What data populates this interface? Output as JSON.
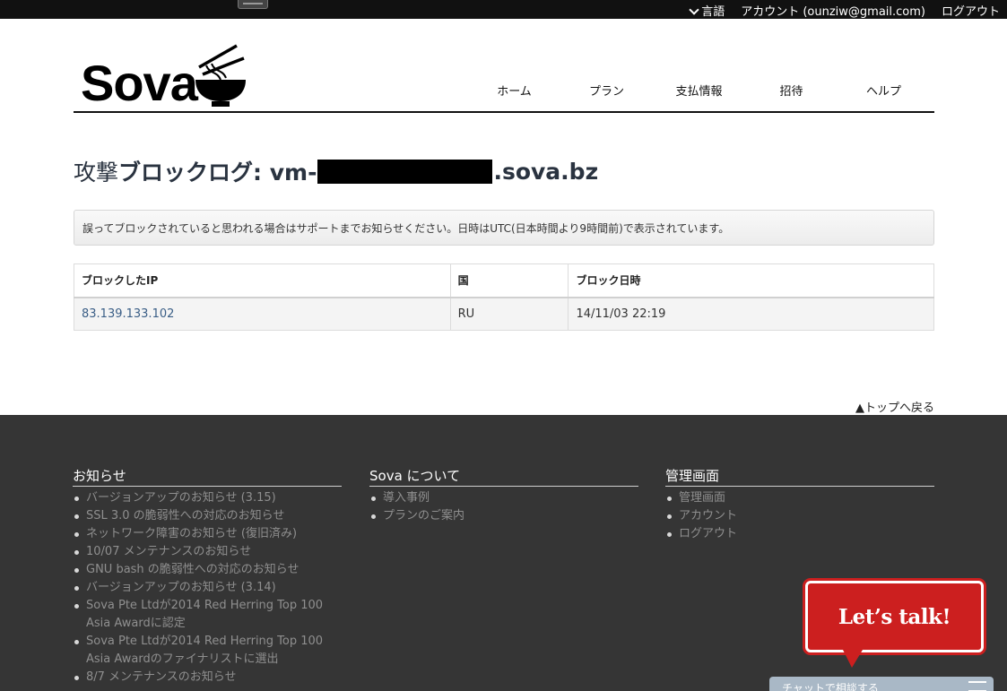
{
  "topbar": {
    "language": "言語",
    "account": "アカウント (ounziw@gmail.com)",
    "logout": "ログアウト"
  },
  "brand": {
    "name": "Sova"
  },
  "nav": {
    "items": [
      "ホーム",
      "プラン",
      "支払情報",
      "招待",
      "ヘルプ"
    ]
  },
  "title": {
    "prefix": "攻撃",
    "label": "ブロックログ: vm-",
    "suffix": ".sova.bz"
  },
  "notice": "誤ってブロックされていると思われる場合はサポートまでお知らせください。日時はUTC(日本時間より9時間前)で表示されています。",
  "table": {
    "headers": [
      "ブロックしたIP",
      "国",
      "ブロック日時"
    ],
    "rows": [
      {
        "ip": "83.139.133.102",
        "country": "RU",
        "datetime": "14/11/03 22:19"
      }
    ]
  },
  "back_to_top": "▲トップへ戻る",
  "footer": {
    "news": {
      "heading": "お知らせ",
      "items": [
        "バージョンアップのお知らせ (3.15)",
        "SSL 3.0 の脆弱性への対応のお知らせ",
        "ネットワーク障害のお知らせ (復旧済み)",
        "10/07 メンテナンスのお知らせ",
        "GNU bash の脆弱性への対応のお知らせ",
        "バージョンアップのお知らせ (3.14)",
        "Sova Pte Ltdが2014 Red Herring Top 100 Asia Awardに認定",
        "Sova Pte Ltdが2014 Red Herring Top 100 Asia Awardのファイナリストに選出",
        "8/7 メンテナンスのお知らせ"
      ]
    },
    "about": {
      "heading": "Sova について",
      "items": [
        "導入事例",
        "プランのご案内"
      ]
    },
    "admin": {
      "heading": "管理画面",
      "items": [
        "管理画面",
        "アカウント",
        "ログアウト"
      ]
    }
  },
  "chat": {
    "badge": "Let’s talk!",
    "bar_label": "チャットで相談する"
  },
  "colors": {
    "footer_bg": "#353535",
    "badge_red": "#cc1f1f",
    "link_blue": "#3a5e86"
  }
}
